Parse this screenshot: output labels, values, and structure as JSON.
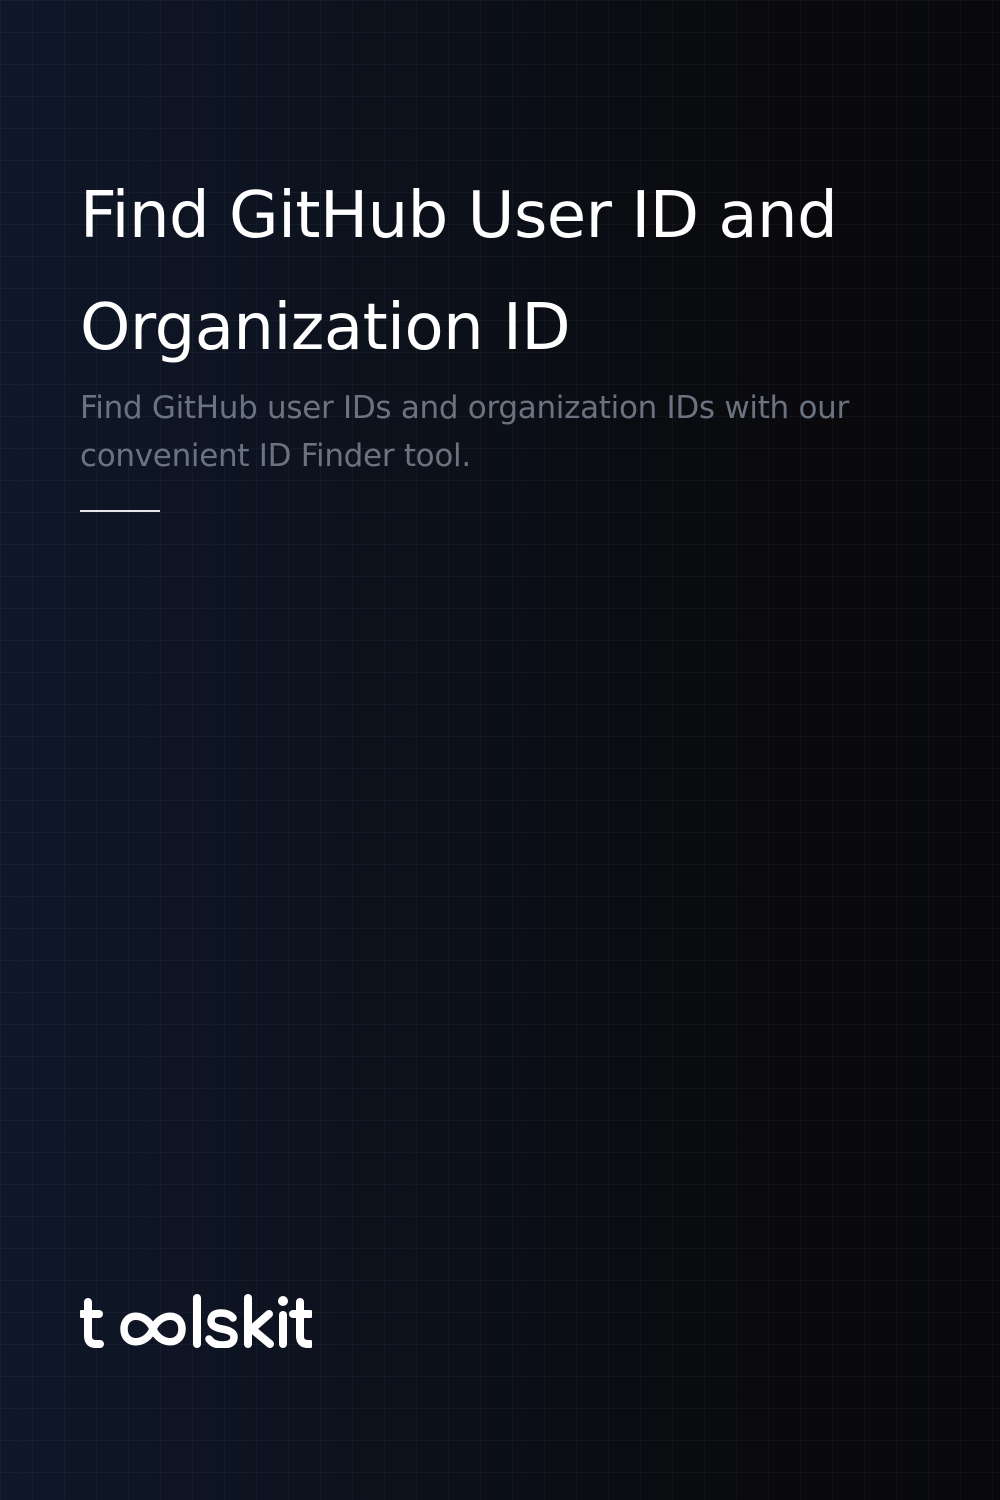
{
  "hero": {
    "title": "Find GitHub User ID and Organization ID",
    "subtitle": "Find GitHub user IDs and organization IDs with our convenient ID Finder tool."
  },
  "brand": {
    "logo_text": "toolskit",
    "color": "#ffffff"
  },
  "theme": {
    "background_start": "#0f1729",
    "background_end": "#09090b",
    "title_color": "#ffffff",
    "subtitle_color": "#6b7280",
    "divider_color": "#e5e7eb"
  }
}
